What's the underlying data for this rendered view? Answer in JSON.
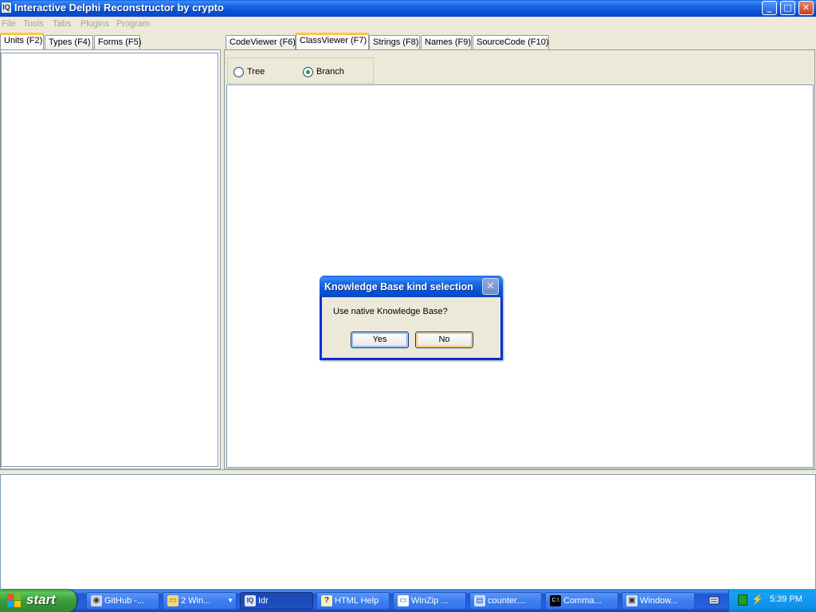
{
  "window": {
    "title": "Interactive Delphi Reconstructor by crypto",
    "app_icon_text": "IQ",
    "min_glyph": "_",
    "max_glyph": "□",
    "close_glyph": "✕"
  },
  "menu": {
    "items": [
      "File",
      "Tools",
      "Tabs",
      "Plugins",
      "Program"
    ],
    "enabled": false
  },
  "left_tabs": [
    "Units (F2)",
    "Types (F4)",
    "Forms (F5)"
  ],
  "left_active_tab": "Units (F2)",
  "right_tabs": [
    "CodeViewer (F6)",
    "ClassViewer (F7)",
    "Strings (F8)",
    "Names (F9)",
    "SourceCode (F10)"
  ],
  "right_active_tab": "ClassViewer (F7)",
  "class_viewer": {
    "options": [
      {
        "label": "Tree",
        "checked": false
      },
      {
        "label": "Branch",
        "checked": true
      }
    ]
  },
  "dialog": {
    "title": "Knowledge Base kind selection",
    "message": "Use native Knowledge Base?",
    "yes_label": "Yes",
    "no_label": "No",
    "close_glyph": "✕"
  },
  "taskbar": {
    "start_label": "start",
    "tasks": [
      {
        "label": "GitHub -...",
        "icon": "github-icon",
        "glyph": "◉",
        "active": false
      },
      {
        "label": "2 Win...",
        "icon": "folder-icon",
        "glyph": "▭",
        "active": false,
        "group": true
      },
      {
        "label": "Idr",
        "icon": "idr-icon",
        "glyph": "IQ",
        "active": true
      },
      {
        "label": "HTML Help",
        "icon": "help-icon",
        "glyph": "?",
        "active": false
      },
      {
        "label": "WinZip ...",
        "icon": "window-icon",
        "glyph": "▭",
        "active": false
      },
      {
        "label": "counter....",
        "icon": "document-icon",
        "glyph": "▤",
        "active": false
      },
      {
        "label": "Comma...",
        "icon": "console-icon",
        "glyph": "C:\\",
        "active": false
      },
      {
        "label": "Window...",
        "icon": "computer-icon",
        "glyph": "▣",
        "active": false
      }
    ],
    "clock": "5:39 PM"
  },
  "colors": {
    "xp_blue": "#0a5ee6",
    "start_green": "#3c9a3c",
    "tab_highlight": "#ffc83c",
    "tray_blue": "#0c97f2"
  }
}
